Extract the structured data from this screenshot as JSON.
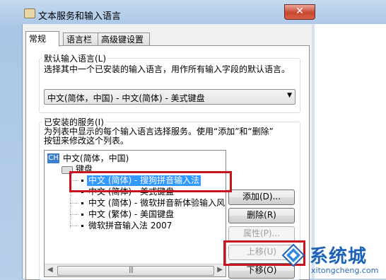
{
  "window": {
    "title": "文本服务和输入语言",
    "close_glyph": "✕"
  },
  "tabs": [
    {
      "label": "常规",
      "active": true
    },
    {
      "label": "语言栏",
      "active": false
    },
    {
      "label": "高级键设置",
      "active": false
    }
  ],
  "default_lang": {
    "group_title": "默认输入语言(L)",
    "description": "选择其中一个已安装的输入语言，用作所有输入字段的默认语言。",
    "selected": "中文(简体，中国) - 中文(简体) - 美式键盘",
    "arrow": "▼"
  },
  "installed": {
    "group_title": "已安装的服务(I)",
    "description_line1": "为列表中显示的每个输入语言选择服务。使用“添加”和“删除”",
    "description_line2": "按钮来修改这个列表。",
    "language_badge": "CH",
    "language_label": "中文(简体，中国)",
    "keyboard_label": "键盘",
    "services": [
      {
        "label": "中文 (简体) - 搜狗拼音输入法",
        "selected": true
      },
      {
        "label": "中文 (简体) - 美式键盘",
        "selected": false
      },
      {
        "label": "中文 (简体) - 微软拼音新体验输入风",
        "selected": false
      },
      {
        "label": "中文 (繁体) - 美国键盘",
        "selected": false
      },
      {
        "label": "微软拼音输入法 2007",
        "selected": false
      }
    ],
    "scroll_left": "◀",
    "scroll_right": "▶",
    "scroll_grip": "|||"
  },
  "buttons": {
    "add": "添加(D)...",
    "remove": "删除(R)",
    "properties": "属性(P)...",
    "move_up": "上移(U)",
    "move_down": "下移(O)"
  },
  "watermark": {
    "brand": "系统城",
    "url": "xitongcheng.com"
  },
  "colors": {
    "highlight": "#c8141c",
    "selection": "#3399ff",
    "brand": "#1d63b8"
  }
}
